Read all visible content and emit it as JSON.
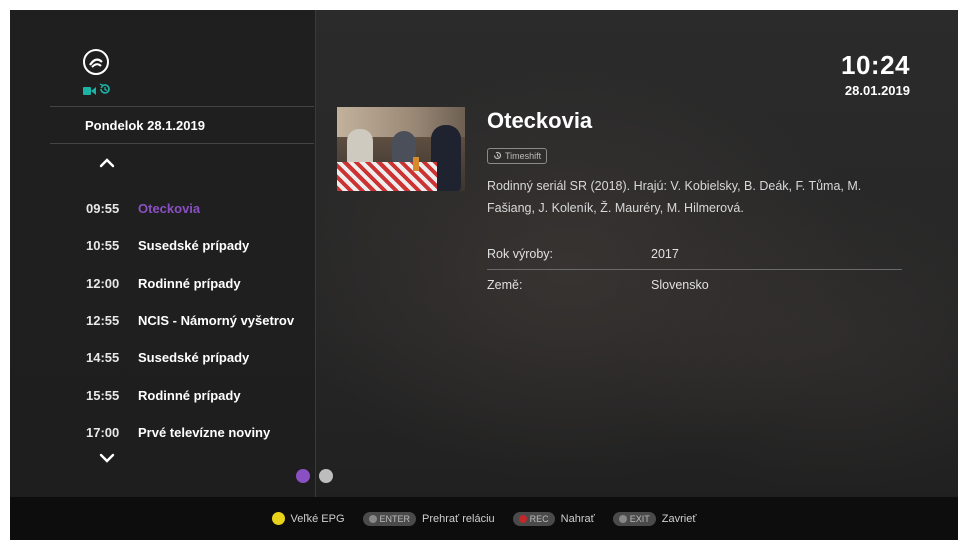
{
  "clock": {
    "time": "10:24",
    "date": "28.01.2019"
  },
  "sidebar": {
    "date": "Pondelok 28.1.2019",
    "schedule": [
      {
        "time": "09:55",
        "title": "Oteckovia",
        "active": true
      },
      {
        "time": "10:55",
        "title": "Susedské prípady",
        "active": false
      },
      {
        "time": "12:00",
        "title": "Rodinné prípady",
        "active": false
      },
      {
        "time": "12:55",
        "title": "NCIS - Námorný vyšetrov",
        "active": false
      },
      {
        "time": "14:55",
        "title": "Susedské prípady",
        "active": false
      },
      {
        "time": "15:55",
        "title": "Rodinné prípady",
        "active": false
      },
      {
        "time": "17:00",
        "title": "Prvé televízne noviny",
        "active": false
      }
    ]
  },
  "detail": {
    "title": "Oteckovia",
    "badge": "Timeshift",
    "description": "Rodinný seriál SR (2018). Hrajú: V. Kobielsky, B. Deák, F. Tůma, M. Fašiang, J. Koleník, Ž. Mauréry, M. Hilmerová.",
    "info": [
      {
        "label": "Rok výroby:",
        "value": "2017"
      },
      {
        "label": "Země:",
        "value": "Slovensko"
      }
    ]
  },
  "pager": {
    "active_color": "#8a4fc2",
    "inactive_color": "#bdbdbd"
  },
  "footer": {
    "hints": [
      {
        "key": "",
        "label": "Veľké EPG"
      },
      {
        "key": "ENTER",
        "label": "Prehrať reláciu"
      },
      {
        "key": "REC",
        "label": "Nahrať"
      },
      {
        "key": "EXIT",
        "label": "Zavrieť"
      }
    ]
  },
  "colors": {
    "accent": "#8a4fc2",
    "channel_icon": "#1ab3a6",
    "yellow_key": "#e8d21a",
    "rec_key": "#c0282c"
  }
}
